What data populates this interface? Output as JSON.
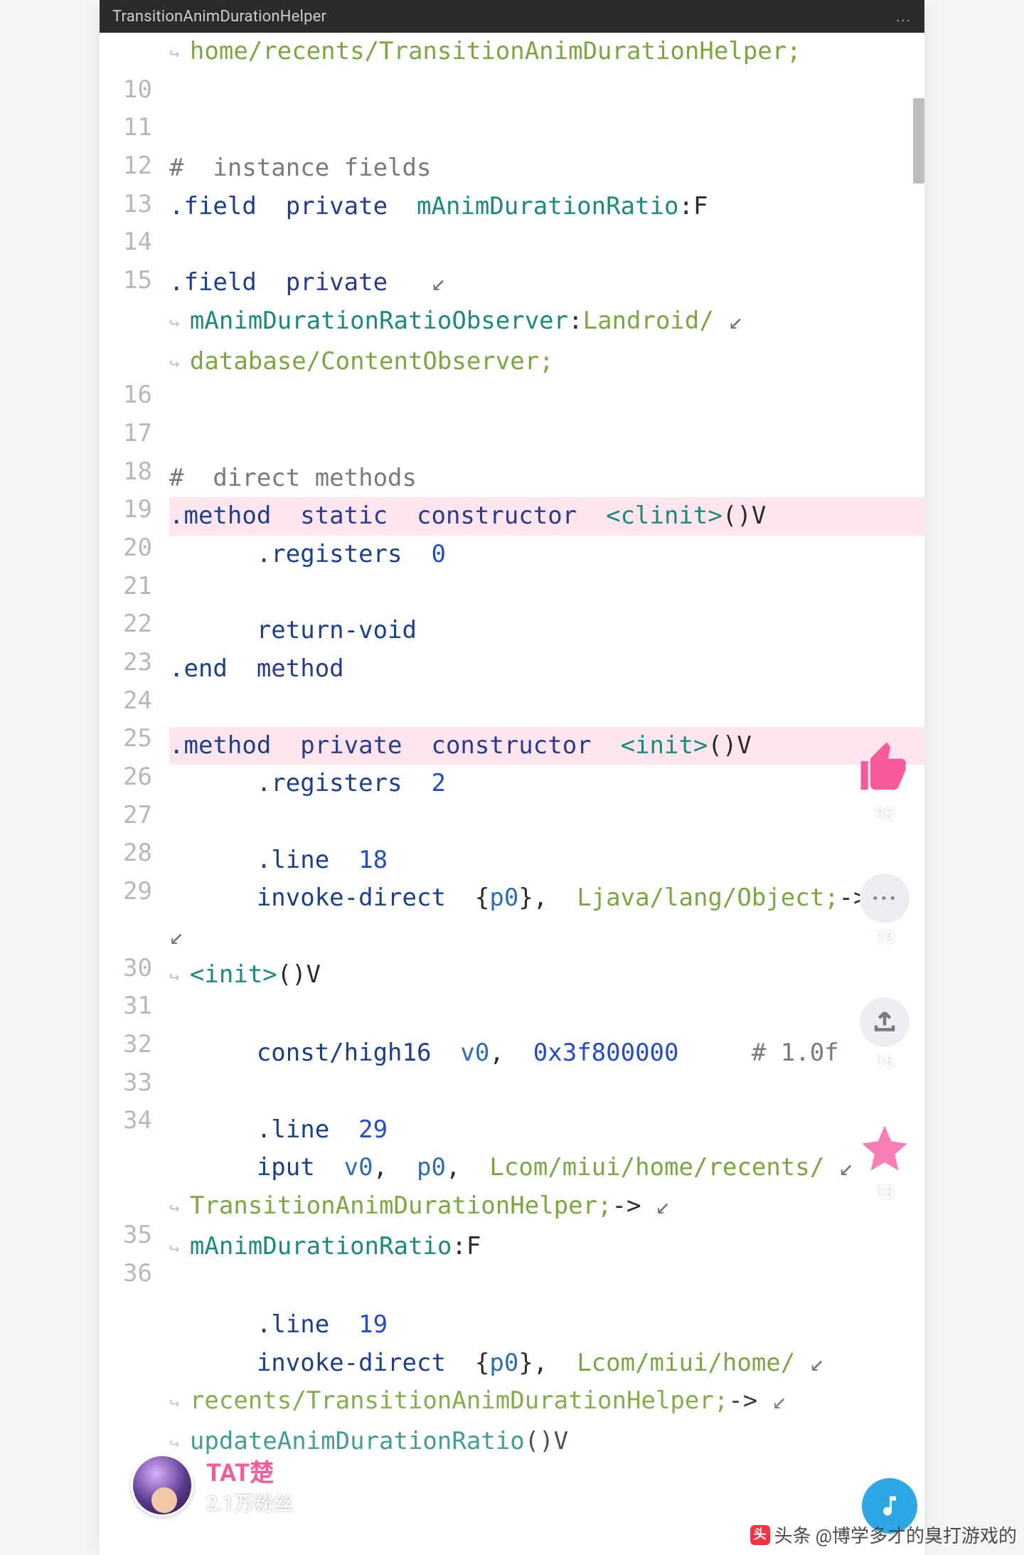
{
  "titlebar": {
    "title": "TransitionAnimDurationHelper",
    "more": "..."
  },
  "gutter": [
    "",
    "10",
    "11",
    "12",
    "13",
    "14",
    "15",
    "",
    "",
    "16",
    "17",
    "18",
    "19",
    "20",
    "21",
    "22",
    "23",
    "24",
    "25",
    "26",
    "27",
    "28",
    "29",
    "",
    "30",
    "31",
    "32",
    "33",
    "34",
    "",
    "",
    "35",
    "36",
    "",
    "",
    ""
  ],
  "code_lines": [
    {
      "hl": false,
      "spans": [
        [
          "wrap",
          ""
        ],
        [
          "green",
          "home/recents/TransitionAnimDurationHelper;"
        ]
      ]
    },
    {
      "hl": false,
      "spans": [
        [
          "",
          ""
        ]
      ]
    },
    {
      "hl": false,
      "spans": [
        [
          "",
          ""
        ]
      ]
    },
    {
      "hl": false,
      "spans": [
        [
          "gray",
          "#  instance fields"
        ]
      ]
    },
    {
      "hl": false,
      "spans": [
        [
          "keyword",
          ".field  "
        ],
        [
          "modifier",
          "private  "
        ],
        [
          "teal",
          "mAnimDurationRatio"
        ],
        [
          "class",
          ":F"
        ]
      ]
    },
    {
      "hl": false,
      "spans": [
        [
          "",
          ""
        ]
      ]
    },
    {
      "hl": false,
      "spans": [
        [
          "keyword",
          ".field  "
        ],
        [
          "modifier",
          "private   "
        ],
        [
          "gray",
          "↙"
        ]
      ]
    },
    {
      "hl": false,
      "spans": [
        [
          "wrap",
          ""
        ],
        [
          "teal",
          "mAnimDurationRatioObserver"
        ],
        [
          "class",
          ":"
        ],
        [
          "green",
          "Landroid/ "
        ],
        [
          "gray",
          "↙"
        ]
      ]
    },
    {
      "hl": false,
      "spans": [
        [
          "wrap",
          ""
        ],
        [
          "green",
          "database/ContentObserver;"
        ]
      ]
    },
    {
      "hl": false,
      "spans": [
        [
          "",
          ""
        ]
      ]
    },
    {
      "hl": false,
      "spans": [
        [
          "",
          ""
        ]
      ]
    },
    {
      "hl": false,
      "spans": [
        [
          "gray",
          "#  direct methods"
        ]
      ]
    },
    {
      "hl": true,
      "spans": [
        [
          "keyword",
          ".method  "
        ],
        [
          "modifier",
          "static  "
        ],
        [
          "modifier",
          "constructor  "
        ],
        [
          "teal",
          "<clinit>"
        ],
        [
          "class",
          "()V"
        ]
      ]
    },
    {
      "hl": false,
      "spans": [
        [
          "",
          "      "
        ],
        [
          "keyword",
          ".registers  "
        ],
        [
          "blue",
          "0"
        ]
      ]
    },
    {
      "hl": false,
      "spans": [
        [
          "",
          ""
        ]
      ]
    },
    {
      "hl": false,
      "spans": [
        [
          "",
          "      "
        ],
        [
          "keyword",
          "return-void"
        ]
      ]
    },
    {
      "hl": false,
      "spans": [
        [
          "keyword",
          ".end  "
        ],
        [
          "modifier",
          "method"
        ]
      ]
    },
    {
      "hl": false,
      "spans": [
        [
          "",
          ""
        ]
      ]
    },
    {
      "hl": true,
      "spans": [
        [
          "keyword",
          ".method  "
        ],
        [
          "modifier",
          "private  "
        ],
        [
          "modifier",
          "constructor  "
        ],
        [
          "teal",
          "<init>"
        ],
        [
          "class",
          "()V"
        ]
      ]
    },
    {
      "hl": false,
      "spans": [
        [
          "",
          "      "
        ],
        [
          "keyword",
          ".registers  "
        ],
        [
          "blue",
          "2"
        ]
      ]
    },
    {
      "hl": false,
      "spans": [
        [
          "",
          ""
        ]
      ]
    },
    {
      "hl": false,
      "spans": [
        [
          "",
          "      "
        ],
        [
          "keyword",
          ".line  "
        ],
        [
          "blue",
          "18"
        ]
      ]
    },
    {
      "hl": false,
      "spans": [
        [
          "",
          "      "
        ],
        [
          "keyword",
          "invoke-direct  "
        ],
        [
          "class",
          "{"
        ],
        [
          "reg",
          "p0"
        ],
        [
          "class",
          "},  "
        ],
        [
          "green",
          "Ljava/lang/Object;"
        ],
        [
          "class",
          "-> "
        ],
        [
          "gray",
          "↙"
        ]
      ]
    },
    {
      "hl": false,
      "spans": [
        [
          "wrap",
          ""
        ],
        [
          "teal",
          "<init>"
        ],
        [
          "class",
          "()V"
        ]
      ]
    },
    {
      "hl": false,
      "spans": [
        [
          "",
          ""
        ]
      ]
    },
    {
      "hl": false,
      "spans": [
        [
          "",
          "      "
        ],
        [
          "keyword",
          "const/high16  "
        ],
        [
          "reg",
          "v0"
        ],
        [
          "class",
          ",  "
        ],
        [
          "blue",
          "0x3f800000     "
        ],
        [
          "gray",
          "# 1.0f"
        ]
      ]
    },
    {
      "hl": false,
      "spans": [
        [
          "",
          ""
        ]
      ]
    },
    {
      "hl": false,
      "spans": [
        [
          "",
          "      "
        ],
        [
          "keyword",
          ".line  "
        ],
        [
          "blue",
          "29"
        ]
      ]
    },
    {
      "hl": false,
      "spans": [
        [
          "",
          "      "
        ],
        [
          "keyword",
          "iput  "
        ],
        [
          "reg",
          "v0"
        ],
        [
          "class",
          ",  "
        ],
        [
          "reg",
          "p0"
        ],
        [
          "class",
          ",  "
        ],
        [
          "green",
          "Lcom/miui/home/recents/ "
        ],
        [
          "gray",
          "↙"
        ]
      ]
    },
    {
      "hl": false,
      "spans": [
        [
          "wrap",
          ""
        ],
        [
          "green",
          "TransitionAnimDurationHelper;"
        ],
        [
          "class",
          "-> "
        ],
        [
          "gray",
          "↙"
        ]
      ]
    },
    {
      "hl": false,
      "spans": [
        [
          "wrap",
          ""
        ],
        [
          "teal",
          "mAnimDurationRatio"
        ],
        [
          "class",
          ":F"
        ]
      ]
    },
    {
      "hl": false,
      "spans": [
        [
          "",
          ""
        ]
      ]
    },
    {
      "hl": false,
      "spans": [
        [
          "",
          "      "
        ],
        [
          "keyword",
          ".line  "
        ],
        [
          "blue",
          "19"
        ]
      ]
    },
    {
      "hl": false,
      "spans": [
        [
          "",
          "      "
        ],
        [
          "keyword",
          "invoke-direct  "
        ],
        [
          "class",
          "{"
        ],
        [
          "reg",
          "p0"
        ],
        [
          "class",
          "},  "
        ],
        [
          "green",
          "Lcom/miui/home/ "
        ],
        [
          "gray",
          "↙"
        ]
      ]
    },
    {
      "hl": false,
      "spans": [
        [
          "wrap",
          ""
        ],
        [
          "green",
          "recents/TransitionAnimDurationHelper;"
        ],
        [
          "class",
          "-> "
        ],
        [
          "gray",
          "↙"
        ]
      ]
    },
    {
      "hl": false,
      "spans": [
        [
          "wrap",
          ""
        ],
        [
          "teal",
          "updateAnimDurationRatio"
        ],
        [
          "class",
          "()V"
        ]
      ]
    }
  ],
  "siderail": {
    "like_count": "90",
    "comment_count": "19",
    "share_count": "16",
    "star_count": "18"
  },
  "profile": {
    "handle": "TAT楚",
    "fans": "2.1万粉丝"
  },
  "watermark": {
    "prefix": "头条",
    "author": "@博学多才的臭打游戏的"
  }
}
